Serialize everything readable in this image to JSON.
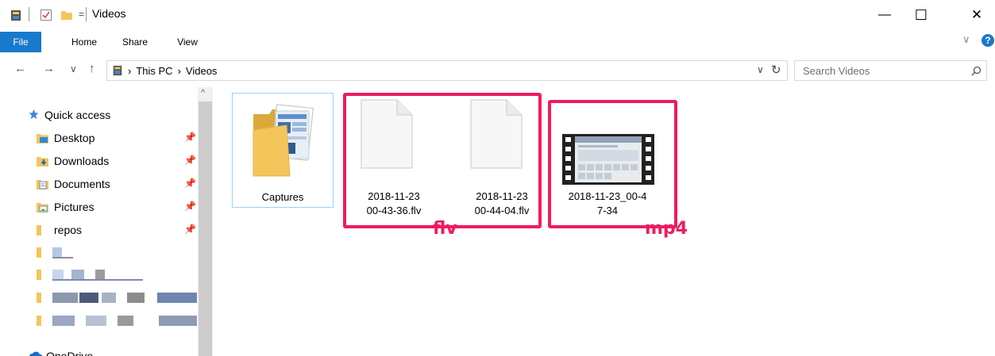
{
  "window": {
    "title": "Videos",
    "minimize_glyph": "—",
    "maximize_glyph": "☐",
    "close_glyph": "✕"
  },
  "ribbon": {
    "tabs": [
      {
        "label": "File"
      },
      {
        "label": "Home"
      },
      {
        "label": "Share"
      },
      {
        "label": "View"
      }
    ],
    "expand_glyph": "∨",
    "help_glyph": "?"
  },
  "nav": {
    "back": "←",
    "forward": "→",
    "recent": "∨",
    "up": "↑"
  },
  "address": {
    "sep": "›",
    "crumbs": [
      "This PC",
      "Videos"
    ],
    "dropdown": "∨",
    "refresh": "↻"
  },
  "search": {
    "placeholder": "Search Videos",
    "icon": "search-icon"
  },
  "sidebar": {
    "scroll_up": "^",
    "quick_access": "Quick access",
    "items": [
      {
        "label": "Desktop",
        "icon": "desktop-folder-icon",
        "pinned": true
      },
      {
        "label": "Downloads",
        "icon": "downloads-folder-icon",
        "pinned": true
      },
      {
        "label": "Documents",
        "icon": "documents-folder-icon",
        "pinned": true
      },
      {
        "label": "Pictures",
        "icon": "pictures-folder-icon",
        "pinned": true
      },
      {
        "label": "repos",
        "icon": "folder-icon",
        "pinned": true
      }
    ],
    "onedrive": "OneDrive"
  },
  "files": [
    {
      "name_line1": "Captures",
      "name_line2": "",
      "icon": "folder-icon",
      "selected": true
    },
    {
      "name_line1": "2018-11-23",
      "name_line2": "00-43-36.flv",
      "icon": "blank-file-icon"
    },
    {
      "name_line1": "2018-11-23",
      "name_line2": "00-44-04.flv",
      "icon": "blank-file-icon"
    },
    {
      "name_line1": "2018-11-23_00-4",
      "name_line2": "7-34",
      "icon": "video-thumbnail-icon"
    }
  ],
  "annotations": {
    "flv": "flv",
    "mp4": "mp4",
    "color": "#ee1c5d"
  },
  "colors": {
    "file_tab": "#1979ca",
    "selection_border": "#99d1ff",
    "folder": "#f4c55a"
  }
}
